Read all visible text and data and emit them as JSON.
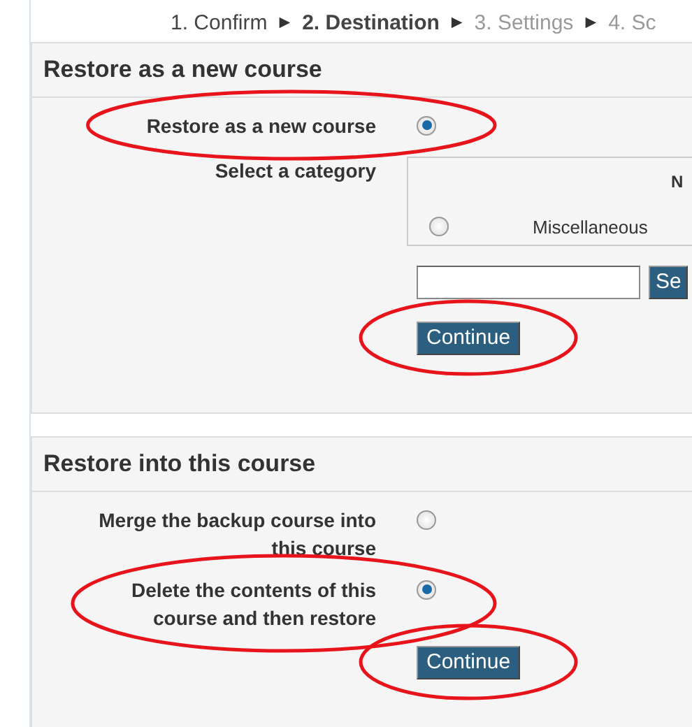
{
  "steps": [
    {
      "kind": "step",
      "label": "1. Confirm",
      "current": false,
      "reached": true
    },
    {
      "kind": "separator",
      "label": "►"
    },
    {
      "kind": "step",
      "label": "2. Destination",
      "current": true,
      "reached": true
    },
    {
      "kind": "separator",
      "label": "►"
    },
    {
      "kind": "step",
      "label": "3. Settings",
      "current": false,
      "reached": false
    },
    {
      "kind": "separator",
      "label": "►"
    },
    {
      "kind": "step",
      "label": "4. Sc",
      "current": false,
      "reached": false
    }
  ],
  "sections": [
    {
      "title": "Restore as a new course",
      "options": [
        {
          "label": "Restore as a new course",
          "selected": true,
          "circled": true
        }
      ],
      "category": {
        "label": "Select a category",
        "column_header": "N",
        "items": [
          {
            "label": "Miscellaneous",
            "selected": false
          }
        ],
        "search_button": "Se"
      },
      "button": {
        "label": "Continue",
        "circled": true
      }
    },
    {
      "title": "Restore into this course",
      "options": [
        {
          "label": "Merge the backup course into this course",
          "selected": false,
          "circled": false
        },
        {
          "label": "Delete the contents of this course and then restore",
          "selected": true,
          "circled": true
        }
      ],
      "button": {
        "label": "Continue",
        "circled": true
      }
    }
  ]
}
